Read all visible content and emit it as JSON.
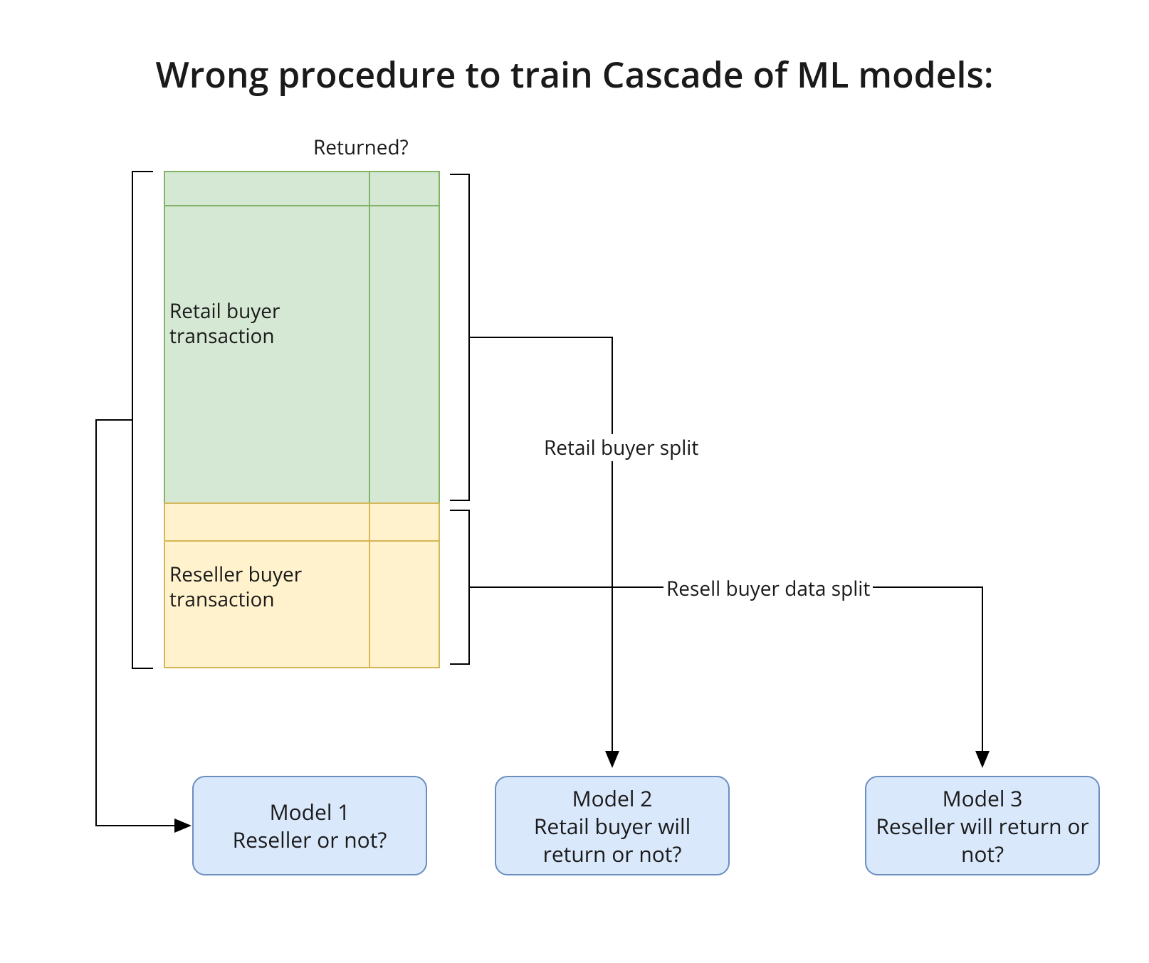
{
  "title": "Wrong procedure to train Cascade of ML models:",
  "table": {
    "column_header": "Returned?",
    "retail_label": "Retail buyer\ntransaction",
    "reseller_label": "Reseller buyer\ntransaction"
  },
  "edges": {
    "retail_split": "Retail buyer split",
    "resell_split": "Resell buyer data split"
  },
  "models": {
    "m1": "Model 1\nReseller or not?",
    "m2": "Model 2\nRetail buyer will return or not?",
    "m3": "Model 3\nReseller will return or not?"
  }
}
